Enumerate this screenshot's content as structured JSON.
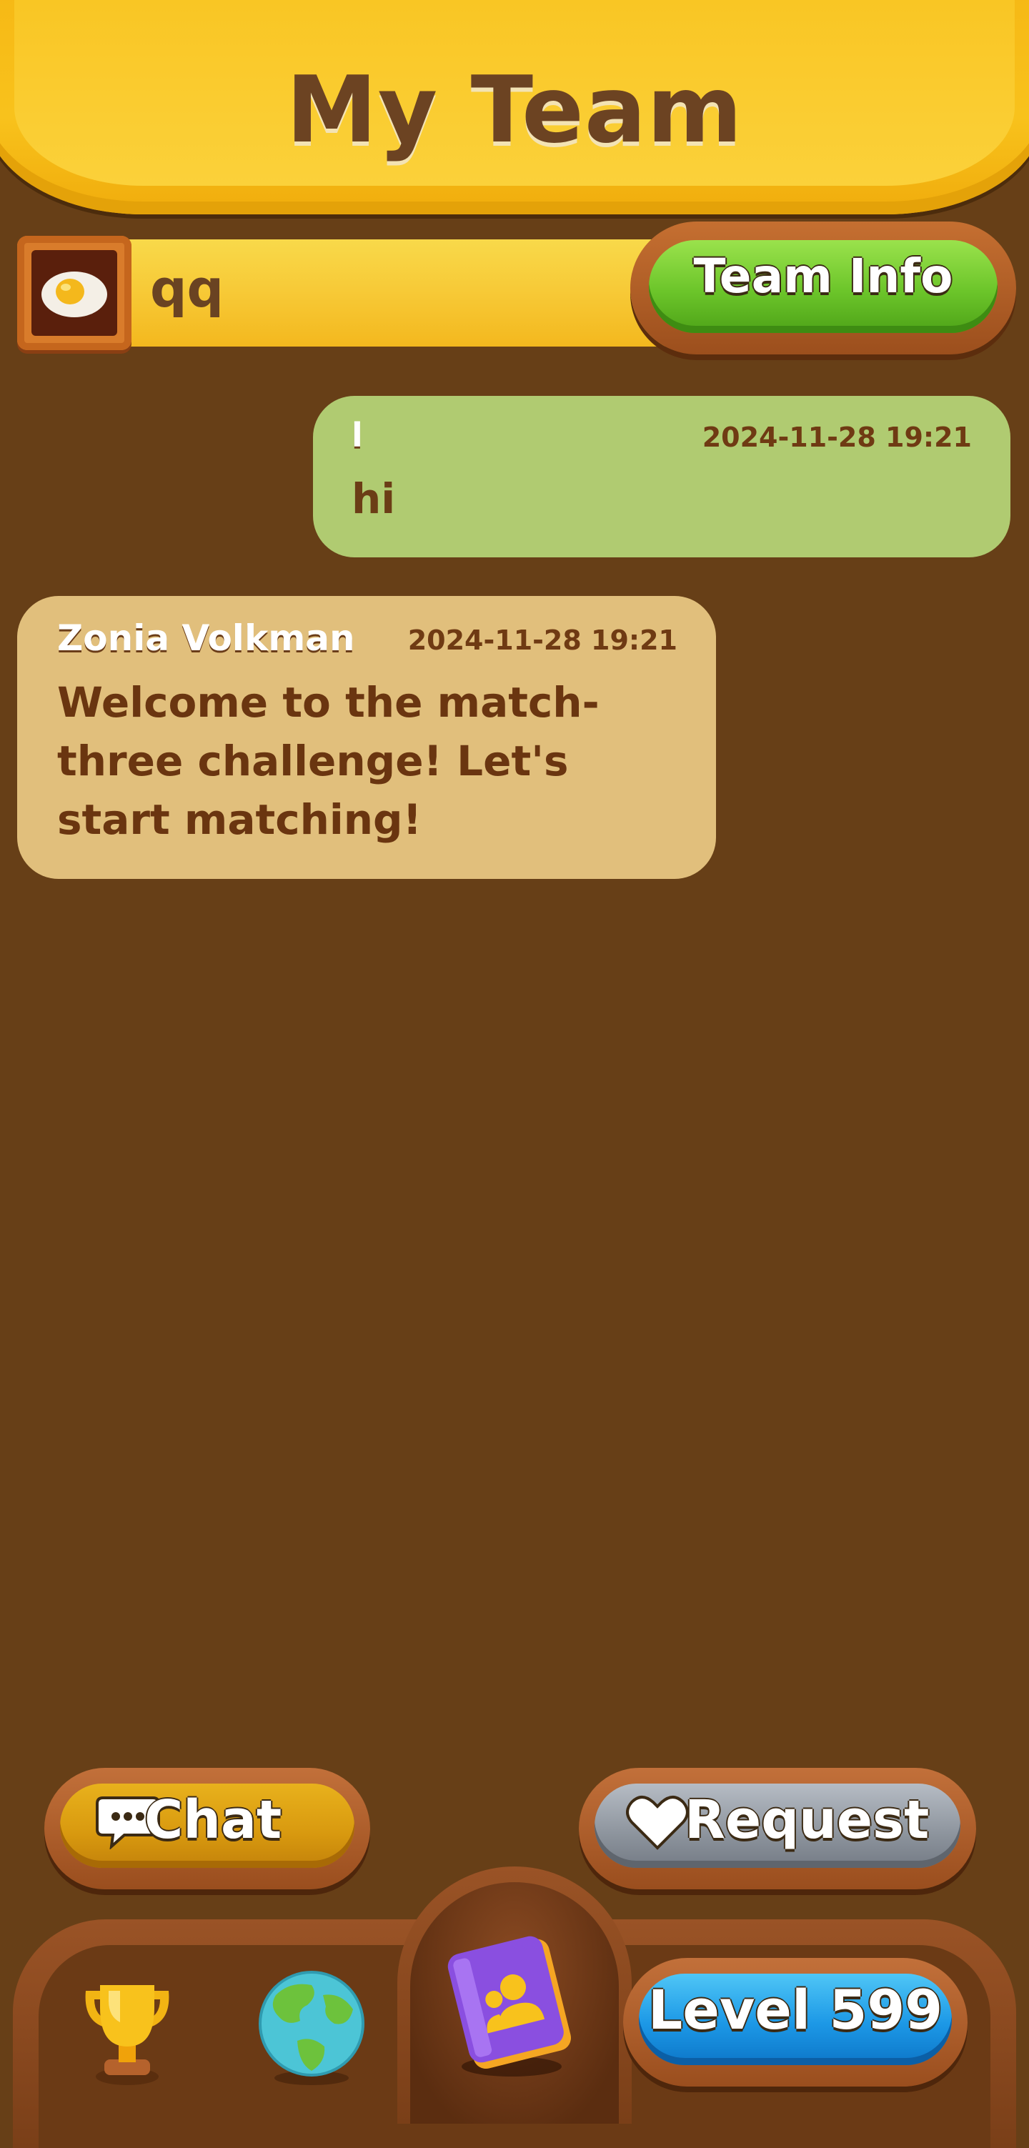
{
  "header": {
    "title": "My Team"
  },
  "team": {
    "name": "qq",
    "info_button": "Team Info"
  },
  "messages": [
    {
      "author": "l",
      "time": "2024-11-28 19:21",
      "text": "hi",
      "own": true
    },
    {
      "author": "Zonia Volkman",
      "time": "2024-11-28 19:21",
      "text": "Welcome to the match-three challenge! Let's start matching!",
      "own": false
    }
  ],
  "actions": {
    "chat_label": "Chat",
    "request_label": "Request"
  },
  "nav": {
    "items": [
      {
        "icon": "trophy-icon"
      },
      {
        "icon": "globe-icon"
      },
      {
        "icon": "team-book-icon",
        "active": true
      }
    ],
    "level_label": "Level 599"
  },
  "colors": {
    "background": "#673f17",
    "header": "#f8c21c",
    "own_bubble": "#b0cb71",
    "other_bubble": "#e1bf7c",
    "team_info_button": "#6cc52a",
    "chat_button": "#d8990f",
    "request_button": "#8d949d",
    "level_button": "#1c98e6"
  }
}
